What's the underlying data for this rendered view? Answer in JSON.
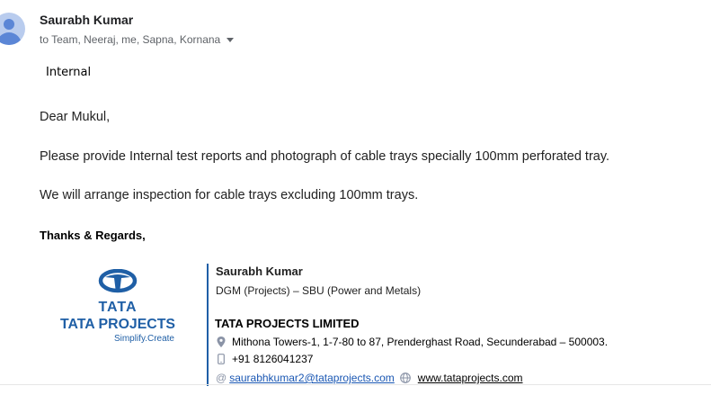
{
  "email": {
    "sender_name": "Saurabh Kumar",
    "recipients": "to Team, Neeraj, me, Sapna, Kornana",
    "classification": "Internal",
    "greeting": "Dear Mukul,",
    "paragraph_1": "Please provide Internal test reports and photograph of cable trays specially 100mm perforated tray.",
    "paragraph_2": "We will arrange inspection for cable trays excluding 100mm trays.",
    "closing": "Thanks & Regards,"
  },
  "signature": {
    "name": "Saurabh Kumar",
    "title": "DGM (Projects) – SBU (Power and Metals)",
    "company": "TATA PROJECTS LIMITED",
    "address": "Mithona Towers-1, 1-7-80 to 87, Prenderghast Road, Secunderabad – 500003.",
    "phone": "+91 8126041237",
    "email": "saurabhkumar2@tataprojects.com",
    "website": "www.tataprojects.com"
  },
  "logo": {
    "wordmark": "TATA",
    "company_text": "TATA PROJECTS",
    "tagline": "Simplify.Create"
  },
  "icons": {
    "avatar": "avatar-icon",
    "recipients_dropdown": "chevron-down-icon",
    "address": "location-pin-icon",
    "phone": "mobile-phone-icon",
    "email": "at-sign-icon",
    "website": "globe-icon"
  },
  "colors": {
    "brand_blue": "#1f5fa6",
    "link_blue": "#1a57b3",
    "avatar_bg": "#b9ccee",
    "avatar_fg": "#5b86d6"
  }
}
